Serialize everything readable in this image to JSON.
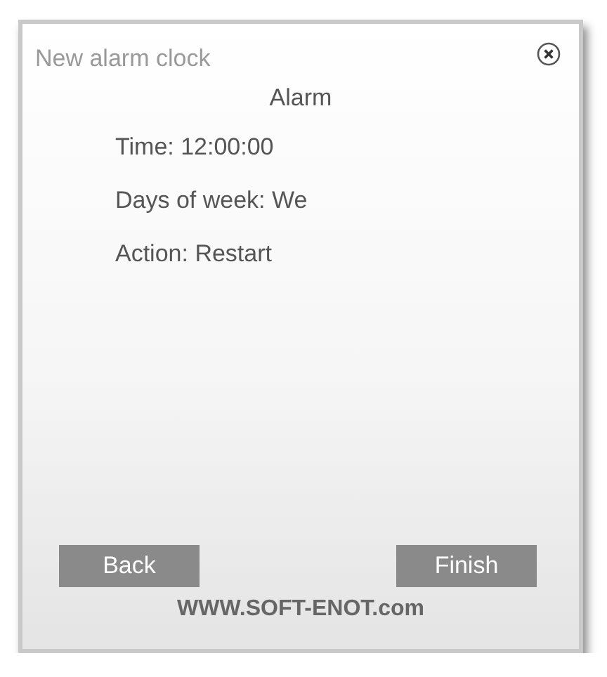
{
  "window": {
    "title": "New alarm clock"
  },
  "heading": "Alarm",
  "details": [
    "Time: 12:00:00",
    "Days of week: We",
    "Action: Restart"
  ],
  "buttons": [
    {
      "label": "Back"
    },
    {
      "label": "Finish"
    }
  ],
  "footer": "WWW.SOFT-ENOT.com"
}
